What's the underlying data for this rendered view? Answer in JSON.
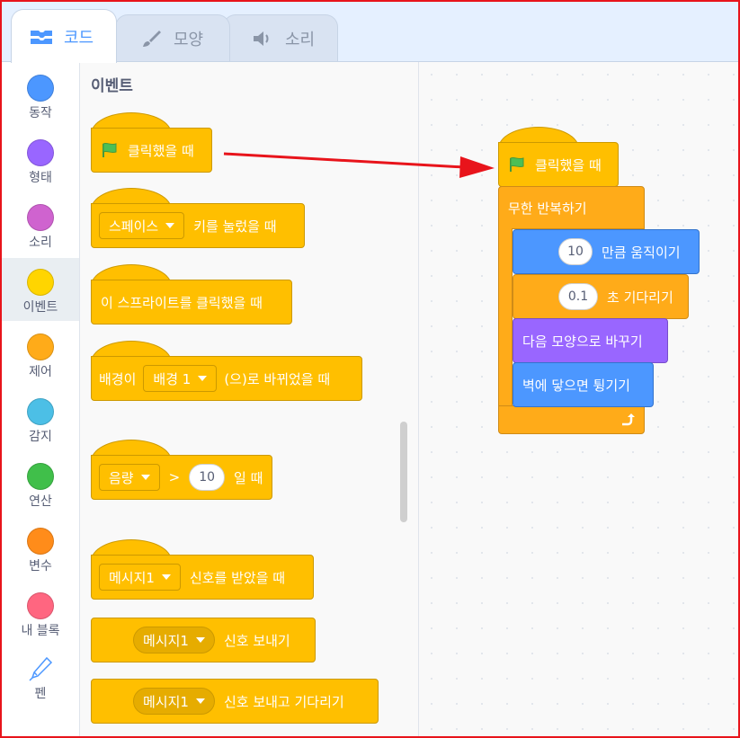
{
  "tabs": [
    {
      "label": "코드",
      "icon": "code-icon"
    },
    {
      "label": "모양",
      "icon": "brush-icon"
    },
    {
      "label": "소리",
      "icon": "speaker-icon"
    }
  ],
  "categories": [
    {
      "label": "동작",
      "color": "#4c97ff"
    },
    {
      "label": "형태",
      "color": "#9966ff"
    },
    {
      "label": "소리",
      "color": "#cf63cf"
    },
    {
      "label": "이벤트",
      "color": "#ffd500"
    },
    {
      "label": "제어",
      "color": "#ffab19"
    },
    {
      "label": "감지",
      "color": "#4cbfe6"
    },
    {
      "label": "연산",
      "color": "#40bf4a"
    },
    {
      "label": "변수",
      "color": "#ff8c1a"
    },
    {
      "label": "내 블록",
      "color": "#ff6680"
    },
    {
      "label": "펜",
      "color": "pen-icon"
    }
  ],
  "palette": {
    "title": "이벤트",
    "blocks": {
      "flag_clicked": "클릭했을 때",
      "key_dropdown": "스페이스",
      "key_pressed": "키를 눌렀을 때",
      "sprite_clicked": "이 스프라이트를 클릭했을 때",
      "backdrop_prefix": "배경이",
      "backdrop_dropdown": "배경 1",
      "backdrop_suffix": "(으)로 바뀌었을 때",
      "volume_dropdown": "음량",
      "gt_symbol": ">",
      "volume_value": "10",
      "volume_suffix": "일 때",
      "msg_dropdown_1": "메시지1",
      "msg_received": "신호를 받았을 때",
      "msg_dropdown_2": "메시지1",
      "msg_broadcast": "신호 보내기",
      "msg_dropdown_3": "메시지1",
      "msg_broadcast_wait": "신호 보내고 기다리기"
    }
  },
  "script": {
    "hat": "클릭했을 때",
    "forever": "무한 반복하기",
    "move_value": "10",
    "move_label": "만큼 움직이기",
    "wait_value": "0.1",
    "wait_label": "초 기다리기",
    "costume_label": "다음 모양으로 바꾸기",
    "bounce_label": "벽에 닿으면 튕기기"
  },
  "colors": {
    "events": "#ffbf00",
    "control": "#ffab19",
    "motion": "#4c97ff",
    "looks": "#9966ff",
    "arrow": "#e8141b",
    "frame": "#e8141b"
  }
}
